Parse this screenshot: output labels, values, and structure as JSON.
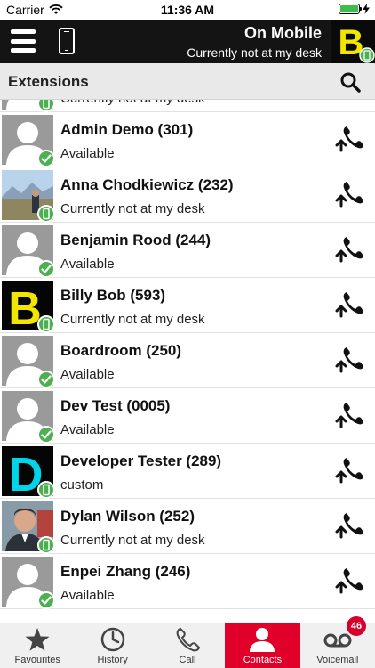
{
  "status_bar": {
    "carrier": "Carrier",
    "time": "11:36 AM"
  },
  "header": {
    "title": "On Mobile",
    "subtitle": "Currently not at my desk"
  },
  "section": {
    "title": "Extensions"
  },
  "contacts": [
    {
      "name": "",
      "status": "Currently not at my desk",
      "avatar": "b-yellow-mobile-icon",
      "badge": "mobile"
    },
    {
      "name": "Admin Demo (301)",
      "status": "Available",
      "avatar": "placeholder-person-icon",
      "badge": "available"
    },
    {
      "name": "Anna Chodkiewicz (232)",
      "status": "Currently not at my desk",
      "avatar": "landscape-photo",
      "badge": "mobile"
    },
    {
      "name": "Benjamin Rood (244)",
      "status": "Available",
      "avatar": "placeholder-person-icon",
      "badge": "available"
    },
    {
      "name": "Billy Bob (593)",
      "status": "Currently not at my desk",
      "avatar": "letter-b-yellow",
      "badge": "mobile"
    },
    {
      "name": "Boardroom (250)",
      "status": "Available",
      "avatar": "placeholder-person-icon",
      "badge": "available"
    },
    {
      "name": "Dev Test (0005)",
      "status": "Available",
      "avatar": "placeholder-person-icon",
      "badge": "available"
    },
    {
      "name": "Developer Tester (289)",
      "status": "custom",
      "avatar": "letter-d-cyan",
      "badge": "mobile"
    },
    {
      "name": "Dylan Wilson (252)",
      "status": "Currently not at my desk",
      "avatar": "person-photo",
      "badge": "mobile"
    },
    {
      "name": "Enpei Zhang (246)",
      "status": "Available",
      "avatar": "placeholder-person-icon",
      "badge": "available"
    }
  ],
  "tabs": [
    {
      "label": "Favourites",
      "icon": "star-icon"
    },
    {
      "label": "History",
      "icon": "clock-icon"
    },
    {
      "label": "Call",
      "icon": "phone-icon"
    },
    {
      "label": "Contacts",
      "icon": "person-icon",
      "active": true
    },
    {
      "label": "Voicemail",
      "icon": "voicemail-icon",
      "badge": "46"
    }
  ],
  "colors": {
    "accent_red": "#e0002a",
    "available_green": "#4caf50",
    "header_bg": "#141414",
    "brand_yellow": "#f2e600",
    "brand_cyan": "#00d4e8"
  }
}
